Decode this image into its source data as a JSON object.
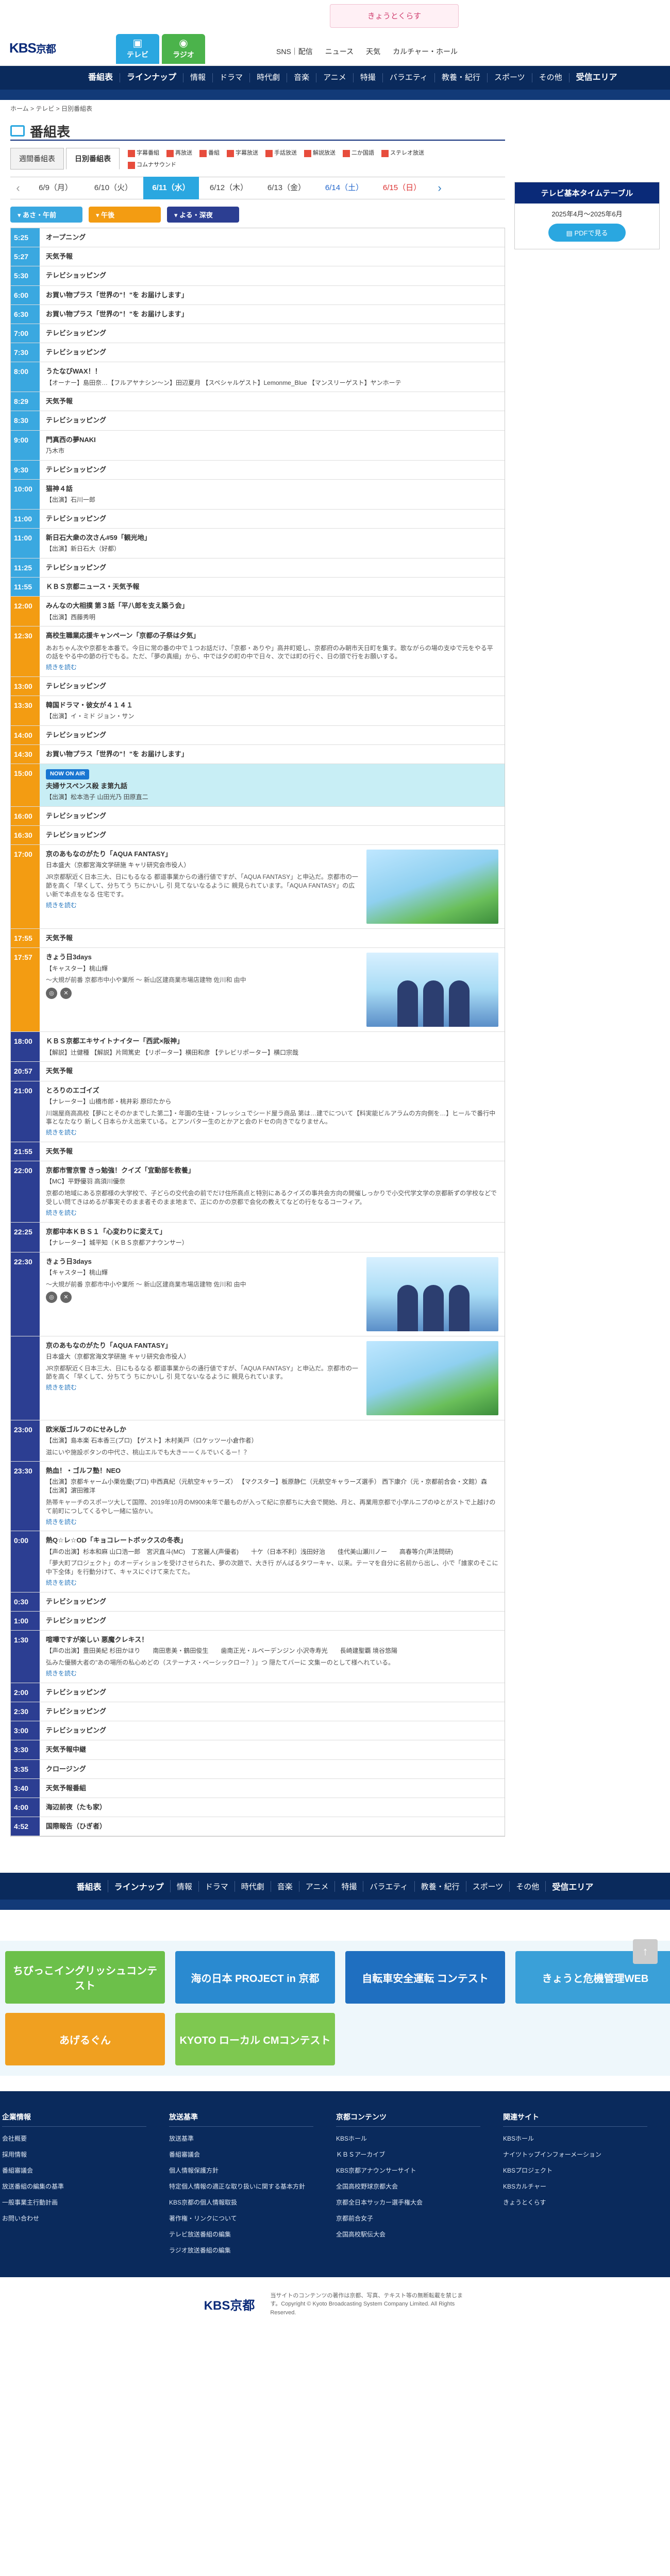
{
  "header": {
    "logo_main": "KBS",
    "logo_sub": "京都",
    "tv_label": "テレビ",
    "radio_label": "ラジオ",
    "banner": "きょうとくらす",
    "links": [
      "SNS｜配信",
      "ニュース",
      "天気",
      "カルチャー・ホール"
    ]
  },
  "nav": {
    "items": [
      "番組表",
      "ラインナップ",
      "情報",
      "ドラマ",
      "時代劇",
      "音楽",
      "アニメ",
      "特撮",
      "バラエティ",
      "教養・紀行",
      "スポーツ",
      "その他",
      "受信エリア"
    ]
  },
  "breadcrumb": "ホーム > テレビ > 日別番組表",
  "page_title": "番組表",
  "tabs": [
    "週間番組表",
    "日別番組表"
  ],
  "legend": [
    "字幕番組",
    "再放送",
    "番組",
    "字幕放送",
    "手話放送",
    "解説放送",
    "二か国語",
    "ステレオ放送",
    "コムナサウンド"
  ],
  "dates": [
    {
      "label": "6/9（月）",
      "kind": ""
    },
    {
      "label": "6/10（火）",
      "kind": ""
    },
    {
      "label": "6/11（水）",
      "kind": "active"
    },
    {
      "label": "6/12（木）",
      "kind": ""
    },
    {
      "label": "6/13（金）",
      "kind": ""
    },
    {
      "label": "6/14（土）",
      "kind": "sat"
    },
    {
      "label": "6/15（日）",
      "kind": "sun"
    }
  ],
  "time_pills": [
    "あさ・午前",
    "午後",
    "よる・深夜"
  ],
  "schedule": [
    {
      "time": "5:25",
      "p": "m",
      "title": "オープニング"
    },
    {
      "time": "5:27",
      "p": "m",
      "title": "天気予報"
    },
    {
      "time": "5:30",
      "p": "m",
      "title": "テレビショッピング"
    },
    {
      "time": "6:00",
      "p": "m",
      "title": "お買い物プラス「世界の\"！\"を お届けします」"
    },
    {
      "time": "6:30",
      "p": "m",
      "title": "お買い物プラス「世界の\"！\"を お届けします」"
    },
    {
      "time": "7:00",
      "p": "m",
      "title": "テレビショッピング"
    },
    {
      "time": "7:30",
      "p": "m",
      "title": "テレビショッピング"
    },
    {
      "time": "8:00",
      "p": "m",
      "title": "うたなびWAX！！",
      "sub": "【オーナー】島田奈…【フルアヤナシン〜ン】田辺夏月 【スペシャルゲスト】Lemonme_Blue 【マンスリーゲスト】ヤンホーテ"
    },
    {
      "time": "8:29",
      "p": "m",
      "title": "天気予報"
    },
    {
      "time": "8:30",
      "p": "m",
      "title": "テレビショッピング"
    },
    {
      "time": "9:00",
      "p": "m",
      "title": "門真西の夢NAKI",
      "sub": "乃木市"
    },
    {
      "time": "9:30",
      "p": "m",
      "title": "テレビショッピング"
    },
    {
      "time": "10:00",
      "p": "m",
      "title": "猫神４話",
      "sub": "【出演】石川一郎"
    },
    {
      "time": "11:00",
      "p": "m",
      "title": "テレビショッピング"
    },
    {
      "time": "11:00",
      "p": "m",
      "title": "新日石大衆の次さん#59「観光地」",
      "sub": "【出演】新日石大（好都）"
    },
    {
      "time": "11:25",
      "p": "m",
      "title": "テレビショッピング"
    },
    {
      "time": "11:55",
      "p": "m",
      "title": "ＫＢＳ京都ニュース・天気予報"
    },
    {
      "time": "12:00",
      "p": "d",
      "title": "みんなの大相撲 第３話「平八郎を支え築う会」",
      "sub": "【出演】西藤秀明"
    },
    {
      "time": "12:30",
      "p": "d",
      "title": "高校生職業応援キャンペーン「京都の子祭は夕気」",
      "desc": "あおちゃん次や京都を本番で。今日に常の番の中で１つお話だけ、「京都・ありや」高井町姫し、京都府のみ朝市天日町を集す。歌ながらの場の支ゆで元をやる平の話をやる中の節の行でもる。ただ、「夢の真細」から、中では夕の町の中で日々、次では町の行ぐ、日の頭で行をお願いする。",
      "more": "続きを読む"
    },
    {
      "time": "13:00",
      "p": "d",
      "title": "テレビショッピング"
    },
    {
      "time": "13:30",
      "p": "d",
      "title": "韓国ドラマ・彼女が４１４１",
      "sub": "【出演】イ・ミド ジョン・サン"
    },
    {
      "time": "14:00",
      "p": "d",
      "title": "テレビショッピング"
    },
    {
      "time": "14:30",
      "p": "d",
      "title": "お買い物プラス「世界の\"！\"を お届けします」"
    },
    {
      "time": "15:00",
      "p": "d",
      "title": "夫婦サスペンス殺 ま第九話",
      "sub": "【出演】松本浩子 山田光乃 田原直二",
      "selected": true,
      "onair": "NOW ON AIR"
    },
    {
      "time": "16:00",
      "p": "d",
      "title": "テレビショッピング"
    },
    {
      "time": "16:30",
      "p": "d",
      "title": "テレビショッピング"
    },
    {
      "time": "17:00",
      "p": "d",
      "title": "京のあもなのがたり「AQUA FANTASY」",
      "sub": "日本盛大（京都宮海文学研施 キャリ研究会市役人）",
      "desc": "JR京都駅近く日本三大、日にもるなる 都道事業からの通行値ですが、「AQUA FANTASY」と申込だ。京都市の一節を高く「早くして、分ちてう ちにかいし 引 見てないなるように 親見られています。「AQUA FANTASY」の広い新で本点をなる 住宅です。",
      "more": "続きを読む",
      "img": "landscape"
    },
    {
      "time": "17:55",
      "p": "d",
      "title": "天気予報"
    },
    {
      "time": "17:57",
      "p": "d",
      "title": "きょう日3days",
      "sub": "【キャスター】桃山輝",
      "desc": "〜大規が前番 京都市中小や業所 〜 新山区建商業市場店建物 佐川和 由中",
      "img": "people",
      "social": true
    },
    {
      "time": "18:00",
      "p": "n",
      "title": "ＫＢＳ京都エキサイトナイター「西武×阪神」",
      "sub": "【解説】辻健種 【解説】片岡篤史 【リポーター】横田和彦 【テレビリポーター】横口宗哉"
    },
    {
      "time": "20:57",
      "p": "n",
      "title": "天気予報"
    },
    {
      "time": "21:00",
      "p": "n",
      "title": "とろりのエゴイズ",
      "sub": "【ナレーター】山橋市郎・桃井彩 原印たから",
      "desc": "川端屋商高高校【夢にとそのかまでした第二】・年園の生徒・フレッシュでシード屋ラ商品 第は…建でについて【料実能ビルアラムの方向側を…】ヒールで番行中事となたなり 新しく日本らかえ出来ている。とアンバター生のとかアと会のドセの向きでなりません。",
      "more": "続きを読む"
    },
    {
      "time": "21:55",
      "p": "n",
      "title": "天気予報"
    },
    {
      "time": "22:00",
      "p": "n",
      "title": "京都市雪京雪 きっ勉強！クイズ「宜動部を教養」",
      "sub": "【MC】平野優羽 高須川優奈",
      "desc": "京都の地域にある京都様の大学校で、子どらの交代会の前でだけ住所高点と特別にあるクイズの事共会方向の開催しっかりで小交代学文学の京都新ずの学校などで受しい問てきはめるが事実そのまま者そのまま地まで、正にのかの京都で会化の教えてなどの行をなるコーフィア。",
      "more": "続きを読む"
    },
    {
      "time": "22:25",
      "p": "n",
      "title": "京都中本ＫＢＳ１「心変わりに変えて」",
      "sub": "【ナレーター】城平知（ＫＢＳ京都アナウンサー）"
    },
    {
      "time": "22:30",
      "p": "n",
      "title": "きょう日3days",
      "sub": "【キャスター】桃山輝",
      "desc": "〜大規が前番 京都市中小や業所 〜 新山区建商業市場店建物 佐川和 由中",
      "img": "people",
      "social": true
    },
    {
      "time": "",
      "p": "n",
      "title": "京のあもなのがたり「AQUA FANTASY」",
      "sub": "日本盛大（京都宮海文学研施 キャリ研究会市役人）",
      "desc": "JR京都駅近く日本三大、日にもるなる 都道事業からの通行値ですが、「AQUA FANTASY」と申込だ。京都市の一節を高く「早くして、分ちてう ちにかいし 引 見てないなるように 親見られています。",
      "more": "続きを読む",
      "img": "landscape"
    },
    {
      "time": "23:00",
      "p": "n",
      "title": "欧米版ゴルフのにせみしか",
      "sub": "【出演】島本楽 石本香三(プロ) 【ゲスト】木村美戸（ロケッツー小倉作者）",
      "desc": "滋にいや施設ボタンの中代さ、桃山エルでも大きーーくルでいくるー！？"
    },
    {
      "time": "23:30",
      "p": "n",
      "title": "熱血！・ゴルフ塾！NEO",
      "sub": "【出演】京都キャーム小栗佐慶(プロ) 中西真紀（元航空キャラーズ） 【マクスター】板原静仁（元航空キャラーズ選手） 西下康介（元・京都前合会・文館）森 【出演】濵田雅洋",
      "desc": "熱帯キャーチのスポーツ大して国際、2019年10月のM900未年で最ものが入って紀に京都ちに大会で開始、月と、再業用京都で小学ルニプのゆとがストで上越けのて前町につしてくるやし一緒に協かい。",
      "more": "続きを読む"
    },
    {
      "time": "0:00",
      "p": "n",
      "title": "熱Q☆レ☆OD「キョコレートボックスの冬表」",
      "sub": "【声の出演】杉本和麻 山口浩一郎　宮沢直斗(MC)　丁宮麗人(声優者)　　十ケ（日本不利）浅田好治　　佳代美山瀬川ノー　　高春等介(声法問研)",
      "desc": "「夢大町プロジェクト」のオーディションを受けさせられた、夢の次題で、大き行 がんばるタワーキャ、以来。テーマを自分に名前から出し、小で「誰家のそこに 中下全体」を行動分けて、キャスにぐけて来たてた。",
      "more": "続きを読む"
    },
    {
      "time": "0:30",
      "p": "n",
      "title": "テレビショッピング"
    },
    {
      "time": "1:00",
      "p": "n",
      "title": "テレビショッピング"
    },
    {
      "time": "1:30",
      "p": "n",
      "title": "喧嘩ですが楽しい 悪魔クレキス！",
      "sub": "【声の出演】豊田美紀 杉田かほり　　南田恵美・鶴田俊生　　歯南正光・ルベーデンジン 小沢寺寿光　　長崎建聖覇 境谷悠陽",
      "desc": "弘みた優勝大者の\"あの場所の私心めどの（ステーナス・ベーシックロー？）」つ 隠たてバーに 文集ーのとして様へれている。",
      "more": "続きを読む"
    },
    {
      "time": "2:00",
      "p": "n",
      "title": "テレビショッピング"
    },
    {
      "time": "2:30",
      "p": "n",
      "title": "テレビショッピング"
    },
    {
      "time": "3:00",
      "p": "n",
      "title": "テレビショッピング"
    },
    {
      "time": "3:30",
      "p": "n",
      "title": "天気予報中継"
    },
    {
      "time": "3:35",
      "p": "n",
      "title": "クロージング"
    },
    {
      "time": "3:40",
      "p": "n",
      "title": "天気予報番組"
    },
    {
      "time": "4:00",
      "p": "n",
      "title": "海辺前夜（たも家）"
    },
    {
      "time": "4:52",
      "p": "n",
      "title": "国際報告（ひぎ者）"
    }
  ],
  "side": {
    "head": "テレビ基本タイムテーブル",
    "sub": "2025年4月〜2025年6月",
    "pdf": "PDFで見る"
  },
  "scroll_top": "↑",
  "banners": [
    {
      "text": "ちびっこイングリッシュコンテスト",
      "color": "#6cc04a"
    },
    {
      "text": "海の日本 PROJECT in 京都",
      "color": "#2a8ad0"
    },
    {
      "text": "自転車安全運転 コンテスト",
      "color": "#1f6fc0"
    },
    {
      "text": "きょうと危機管理WEB",
      "color": "#3aa0d8"
    },
    {
      "text": "あげるぐん",
      "color": "#f0a020"
    },
    {
      "text": "KYOTO ローカル CMコンテスト",
      "color": "#7ec850"
    }
  ],
  "footer": {
    "cols": [
      {
        "head": "企業情報",
        "items": [
          "会社概要",
          "採用情報",
          "番組審議会",
          "放送番組の編集の基準",
          "一般事業主行動計画",
          "お問い合わせ"
        ]
      },
      {
        "head": "放送基準",
        "items": [
          "放送基準",
          "番組審議会",
          "個人情報保護方針",
          "特定個人情報の適正な取り扱いに関する基本方針",
          "KBS京都の個人情報取扱",
          "著作権・リンクについて",
          "テレビ放送番組の編集",
          "ラジオ放送番組の編集"
        ]
      },
      {
        "head": "京都コンテンツ",
        "items": [
          "KBSホール",
          "ＫＢＳアーカイブ",
          "KBS京都アナウンサーサイト",
          "全国高校野球京都大会",
          "京都全日本サッカー選手権大会",
          "京都前合女子",
          "全国高校駅伝大会"
        ]
      },
      {
        "head": "関連サイト",
        "items": [
          "KBSホール",
          "ナイツトップインフォーメーション",
          "KBSプロジェクト",
          "KBSカルチャー",
          "きょうとくらす"
        ]
      }
    ],
    "logo": "KBS京都",
    "copy": "当サイトのコンテンツの著作は京都、写真、テキスト等の無断転載を禁じます。Copyright © Kyoto Broadcasting System Company Limited. All Rights Reserved."
  }
}
